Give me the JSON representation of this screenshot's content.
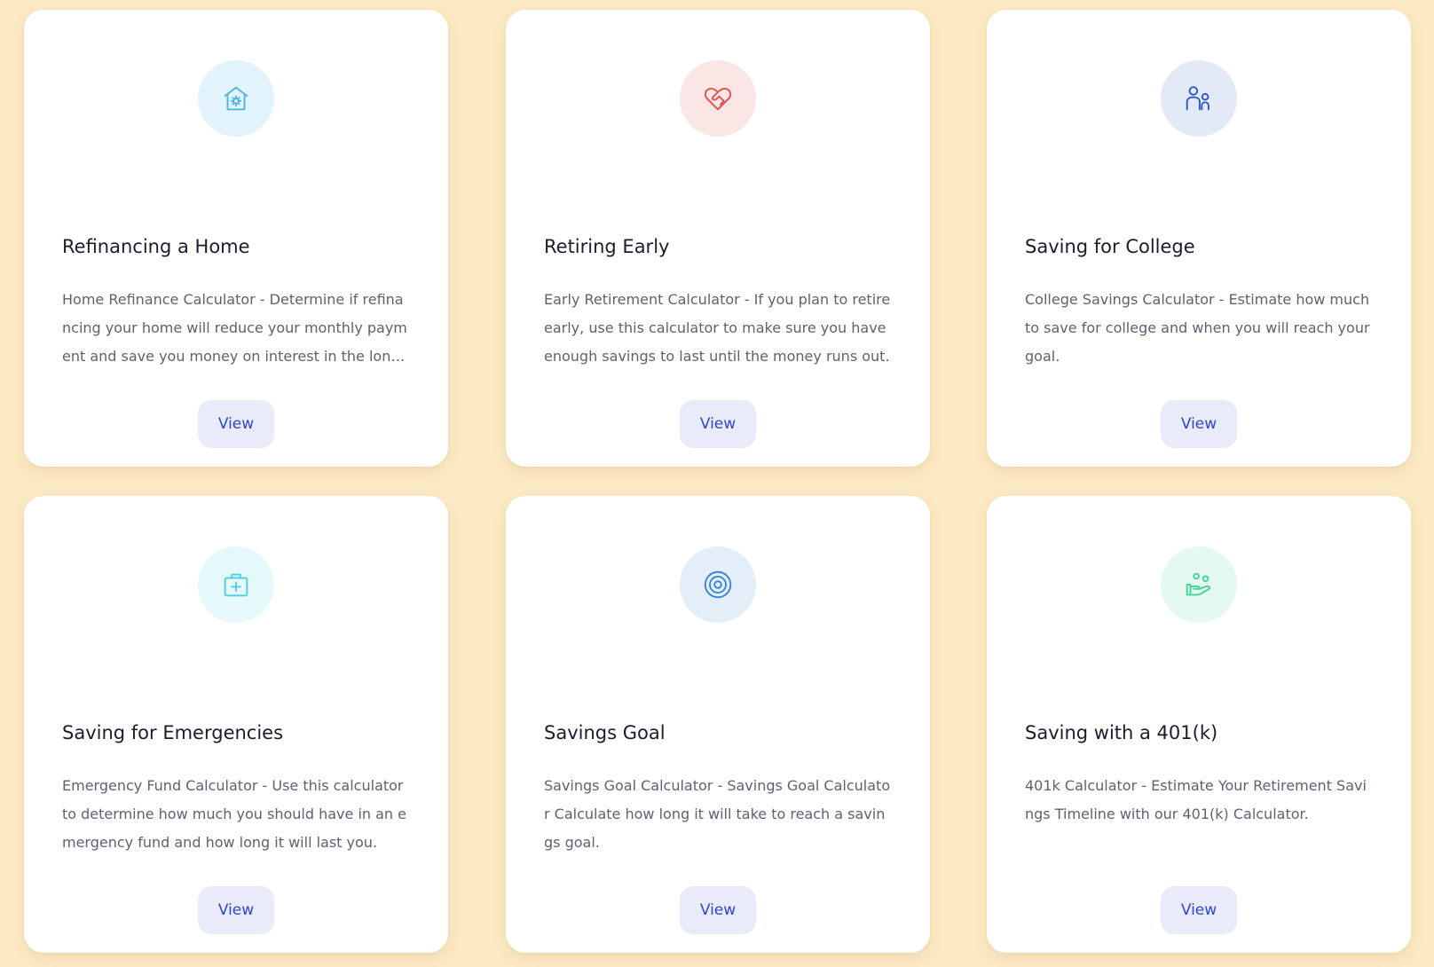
{
  "cards": [
    {
      "title": "Refinancing a Home",
      "description": "Home Refinance Calculator - Determine if refinancing your home will reduce your monthly payment and save you money on interest in the long run.",
      "button_label": "View",
      "icon": "house-gear-icon",
      "icon_color": "#4fb4e4",
      "icon_bg": "#e2f3fb"
    },
    {
      "title": "Retiring Early",
      "description": "Early Retirement Calculator - If you plan to retire early, use this calculator to make sure you have enough savings to last until the money runs out.",
      "button_label": "View",
      "icon": "heart-handshake-icon",
      "icon_color": "#e2504c",
      "icon_bg": "#fbe6e6"
    },
    {
      "title": "Saving for College",
      "description": "College Savings Calculator - Estimate how much to save for college and when you will reach your goal.",
      "button_label": "View",
      "icon": "users-icon",
      "icon_color": "#2e58c4",
      "icon_bg": "#e3eaf7"
    },
    {
      "title": "Saving for Emergencies",
      "description": "Emergency Fund Calculator - Use this calculator to determine how much you should have in an emergency fund and how long it will last you.",
      "button_label": "View",
      "icon": "first-aid-kit-icon",
      "icon_color": "#4fd0e0",
      "icon_bg": "#e5f8fa"
    },
    {
      "title": "Savings Goal",
      "description": "Savings Goal Calculator - Savings Goal Calculator Calculate how long it will take to reach a savings goal.",
      "button_label": "View",
      "icon": "target-icon",
      "icon_color": "#3a86d6",
      "icon_bg": "#e3eef9"
    },
    {
      "title": "Saving with a 401(k)",
      "description": "401k Calculator - Estimate Your Retirement Savings Timeline with our 401(k) Calculator.",
      "button_label": "View",
      "icon": "hand-coins-icon",
      "icon_color": "#46d49a",
      "icon_bg": "#e4f9ef"
    }
  ]
}
